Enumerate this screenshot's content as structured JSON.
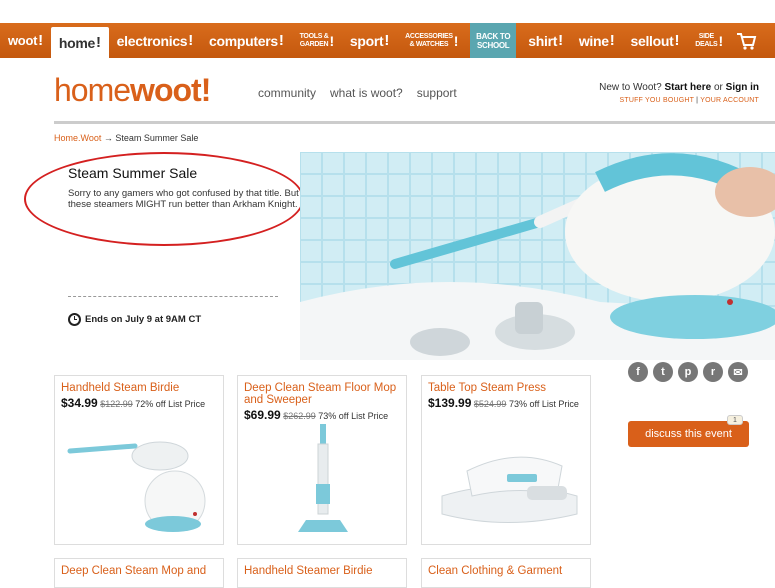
{
  "topnav": {
    "items": [
      {
        "label": "woot",
        "bang": "!"
      },
      {
        "label": "home",
        "bang": "!"
      },
      {
        "label": "electronics",
        "bang": "!"
      },
      {
        "label": "computers",
        "bang": "!"
      },
      {
        "label": "sport",
        "bang": "!"
      },
      {
        "label": "shirt",
        "bang": "!"
      },
      {
        "label": "wine",
        "bang": "!"
      },
      {
        "label": "sellout",
        "bang": "!"
      }
    ],
    "tools_garden": [
      "TOOLS &",
      "GARDEN"
    ],
    "accessories_watches": [
      "ACCESSORIES",
      "& WATCHES"
    ],
    "back_to_school": [
      "BACK TO",
      "SCHOOL"
    ],
    "side_deals": [
      "SIDE",
      "DEALS"
    ],
    "bang": "!"
  },
  "logo": {
    "home": "home",
    "woot": "woot!"
  },
  "mainnav": [
    "community",
    "what is woot?",
    "support"
  ],
  "account": {
    "prefix": "New to Woot?",
    "start_here": "Start here",
    "or": "or",
    "sign_in": "Sign in",
    "stuff_bought": "STUFF YOU BOUGHT",
    "sep": "|",
    "your_account": "YOUR ACCOUNT"
  },
  "breadcrumb": {
    "root": "Home.Woot",
    "arrow": "→",
    "current": "Steam Summer Sale"
  },
  "sale": {
    "title": "Steam Summer Sale",
    "description": "Sorry to any gamers who got confused by that title. But these steamers MIGHT run better than Arkham Knight.",
    "ends": "Ends on July 9 at 9AM CT"
  },
  "social": [
    "f",
    "t",
    "p",
    "r",
    "✉"
  ],
  "discuss": {
    "label": "discuss this event",
    "count": "1"
  },
  "products": [
    {
      "name": "Handheld Steam Birdie",
      "price": "$34.99",
      "list": "$122.99",
      "off": "72% off List Price"
    },
    {
      "name": "Deep Clean Steam Floor Mop and Sweeper",
      "price": "$69.99",
      "list": "$262.99",
      "off": "73% off List Price"
    },
    {
      "name": "Table Top Steam Press",
      "price": "$139.99",
      "list": "$524.99",
      "off": "73% off List Price"
    },
    {
      "name": "Deep Clean Steam Mop and"
    },
    {
      "name": "Handheld Steamer Birdie"
    },
    {
      "name": "Clean Clothing & Garment"
    }
  ],
  "colors": {
    "brand_orange": "#d9601a",
    "nav_orange": "#c4580e",
    "accent_teal": "#5aa6b0"
  }
}
